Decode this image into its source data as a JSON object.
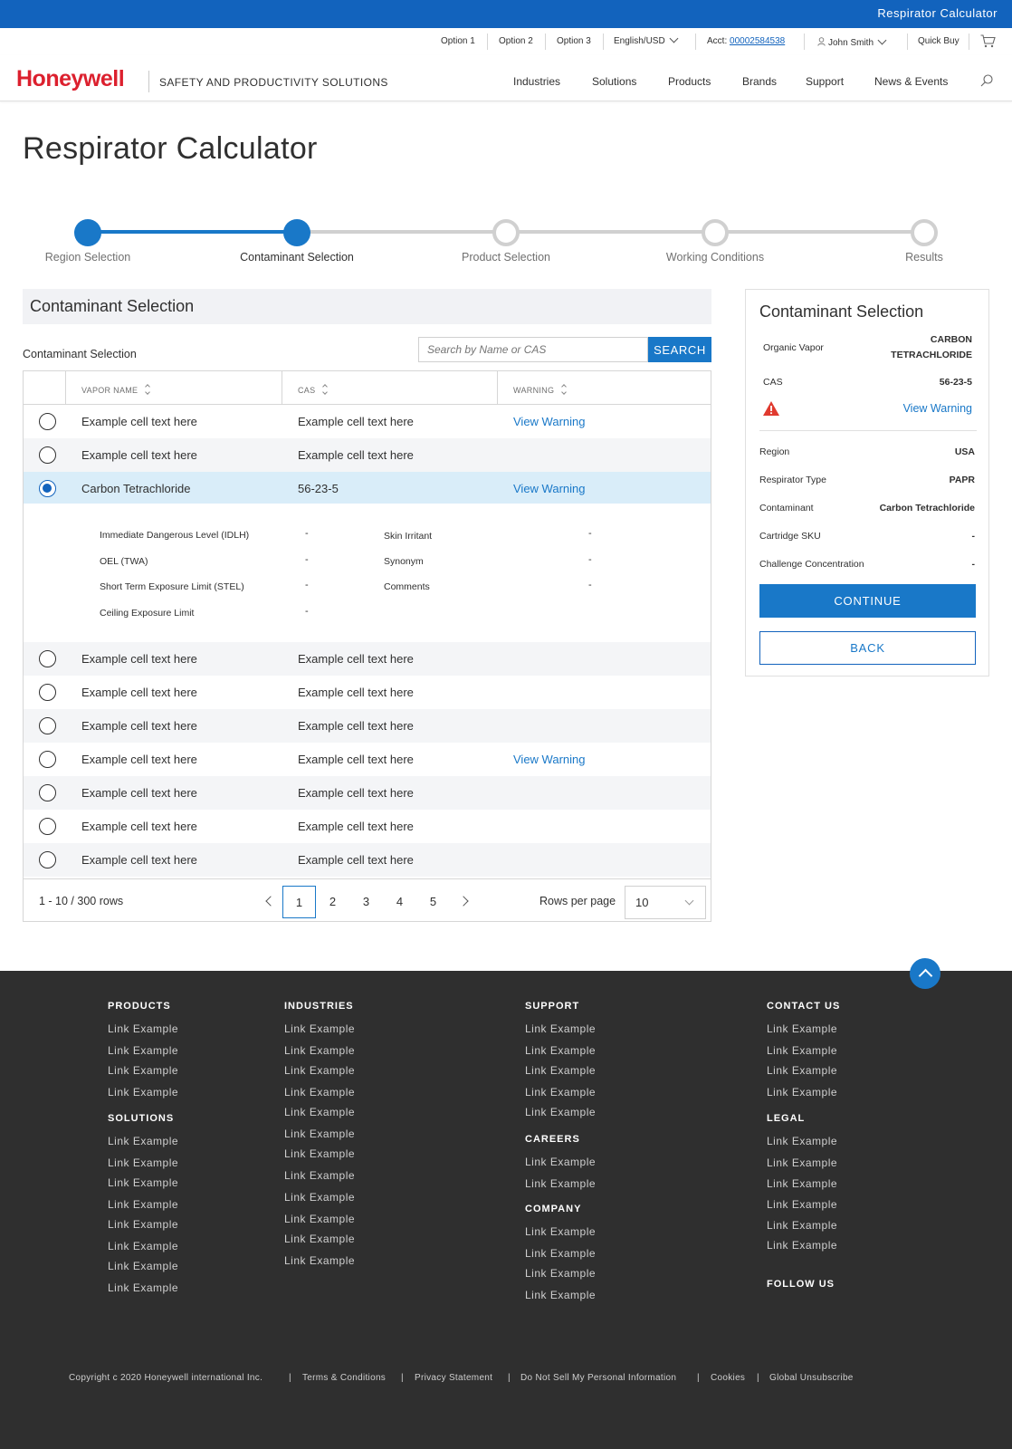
{
  "topbar": {
    "title": "Respirator Calculator"
  },
  "utility": {
    "option1": "Option 1",
    "option2": "Option 2",
    "option3": "Option 3",
    "language": "English/USD",
    "acct_label": "Acct:",
    "acct_number": "00002584538",
    "user": "John Smith",
    "quick_buy": "Quick Buy"
  },
  "header": {
    "logo": "Honeywell",
    "tagline": "SAFETY AND PRODUCTIVITY SOLUTIONS",
    "nav": [
      "Industries",
      "Solutions",
      "Products",
      "Brands",
      "Support",
      "News & Events"
    ]
  },
  "page": {
    "title": "Respirator Calculator"
  },
  "stepper": {
    "steps": [
      "Region Selection",
      "Contaminant Selection",
      "Product Selection",
      "Working Conditions",
      "Results"
    ],
    "current": 2
  },
  "selection": {
    "heading": "Contaminant Selection",
    "sub_label": "Contaminant Selection",
    "search_placeholder": "Search by Name or CAS",
    "search_button": "SEARCH"
  },
  "table": {
    "headers": [
      "VAPOR NAME",
      "CAS",
      "WARNING"
    ],
    "rows": [
      {
        "name": "Example cell text here",
        "cas": "Example cell text here",
        "warning": "View Warning",
        "selected": false
      },
      {
        "name": "Example cell text here",
        "cas": "Example cell text here",
        "warning": "",
        "selected": false
      },
      {
        "name": "Carbon Tetrachloride",
        "cas": "56-23-5",
        "warning": "View Warning",
        "selected": true
      },
      {
        "name": "Example cell text here",
        "cas": "Example cell text here",
        "warning": "",
        "selected": false
      },
      {
        "name": "Example cell text here",
        "cas": "Example cell text here",
        "warning": "",
        "selected": false
      },
      {
        "name": "Example cell text here",
        "cas": "Example cell text here",
        "warning": "",
        "selected": false
      },
      {
        "name": "Example cell text here",
        "cas": "Example cell text here",
        "warning": "View Warning",
        "selected": false
      },
      {
        "name": "Example cell text here",
        "cas": "Example cell text here",
        "warning": "",
        "selected": false
      },
      {
        "name": "Example cell text here",
        "cas": "Example cell text here",
        "warning": "",
        "selected": false
      },
      {
        "name": "Example cell text here",
        "cas": "Example cell text here",
        "warning": "",
        "selected": false
      }
    ],
    "details": {
      "idlh_label": "Immediate Dangerous Level (IDLH)",
      "idlh_value": "-",
      "oel_label": "OEL (TWA)",
      "oel_value": "-",
      "stel_label": "Short Term Exposure Limit (STEL)",
      "stel_value": "-",
      "ceiling_label": "Ceiling Exposure Limit",
      "ceiling_value": "-",
      "skin_label": "Skin Irritant",
      "skin_value": "-",
      "synonym_label": "Synonym",
      "synonym_value": "-",
      "comments_label": "Comments",
      "comments_value": "-"
    },
    "rows_count": "1 - 10 / 300 rows",
    "pages": [
      "1",
      "2",
      "3",
      "4",
      "5"
    ],
    "current_page": "1",
    "rows_per_page_label": "Rows per page",
    "rows_per_page": "10"
  },
  "summary": {
    "heading": "Contaminant Selection",
    "vapor_label": "Organic Vapor",
    "vapor_value_line1": "CARBON",
    "vapor_value_line2": "TETRACHLORIDE",
    "cas_label": "CAS",
    "cas_value": "56-23-5",
    "warning_link": "View Warning",
    "region_label": "Region",
    "region_value": "USA",
    "respirator_label": "Respirator Type",
    "respirator_value": "PAPR",
    "contaminant_label": "Contaminant",
    "contaminant_value": "Carbon Tetrachloride",
    "cartridge_label": "Cartridge SKU",
    "cartridge_value": "-",
    "challenge_label": "Challenge Concentration",
    "challenge_value": "-",
    "continue": "CONTINUE",
    "back": "BACK"
  },
  "footer": {
    "products": "PRODUCTS",
    "solutions": "SOLUTIONS",
    "industries": "INDUSTRIES",
    "support": "SUPPORT",
    "careers": "CAREERS",
    "company": "COMPANY",
    "contact": "CONTACT US",
    "legal": "LEGAL",
    "follow": "FOLLOW US",
    "link": "Link Example",
    "copyright": "Copyright c  2020 Honeywell international Inc.",
    "terms": "Terms & Conditions",
    "privacy": "Privacy Statement",
    "donotsell": "Do Not Sell My Personal Information",
    "cookies": "Cookies",
    "unsubscribe": "Global Unsubscribe",
    "separator": "|"
  },
  "colors": {
    "brand_red": "#dc202e",
    "primary_blue": "#1978c8",
    "top_blue": "#1263bd",
    "footer_bg": "#2f2f2f",
    "selected_row": "#d9edf9",
    "warning_red": "#e03a2f"
  }
}
